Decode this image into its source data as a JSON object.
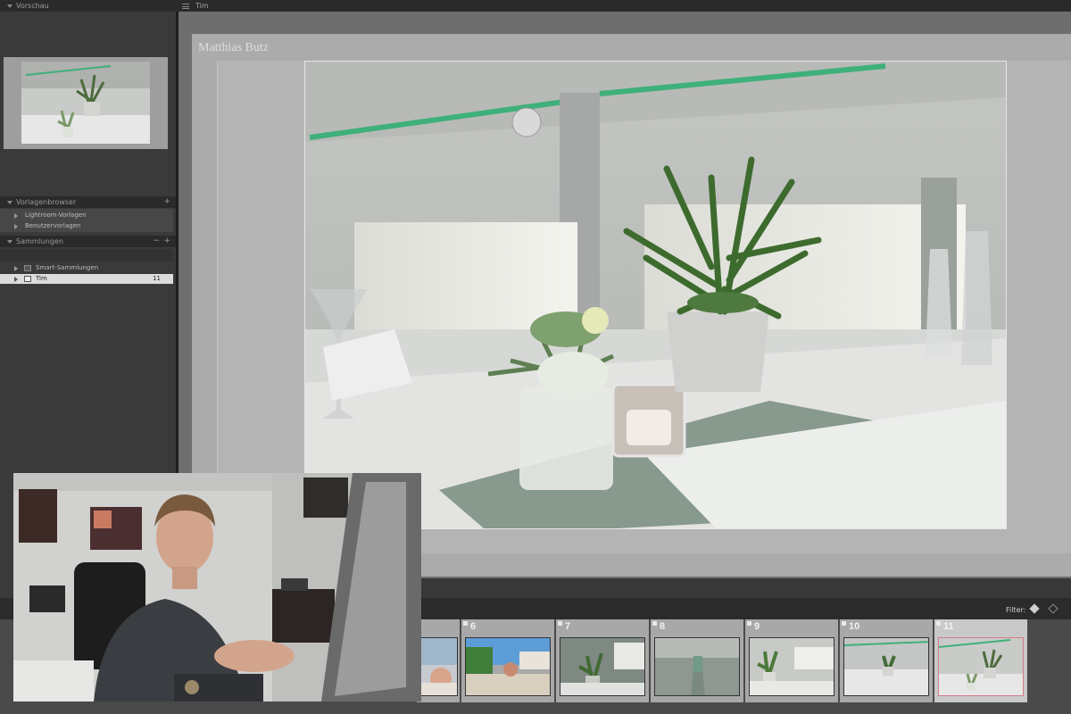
{
  "left_panel": {
    "preview_header": "Vorschau",
    "templates_header": "Vorlagenbrowser",
    "templates": [
      "Lightroom-Vorlagen",
      "Benutzervorlagen"
    ],
    "collections_header": "Sammlungen",
    "collections": [
      {
        "label": "Smart-Sammlungen",
        "count": ""
      },
      {
        "label": "Tim",
        "count": "11"
      }
    ]
  },
  "top_bar": {
    "title": "Tim"
  },
  "page": {
    "author": "Matthias Butz"
  },
  "filmstrip": {
    "filter_label": "Filter:",
    "cells": [
      {
        "num": ""
      },
      {
        "num": "6"
      },
      {
        "num": "7"
      },
      {
        "num": "8"
      },
      {
        "num": "9"
      },
      {
        "num": "10"
      },
      {
        "num": "11"
      }
    ]
  },
  "colors": {
    "accent_green": "#3fb07a",
    "selection_border": "#d57a8a",
    "panel_bg": "#3a3a3a",
    "header_bg": "#2a2a2a"
  }
}
